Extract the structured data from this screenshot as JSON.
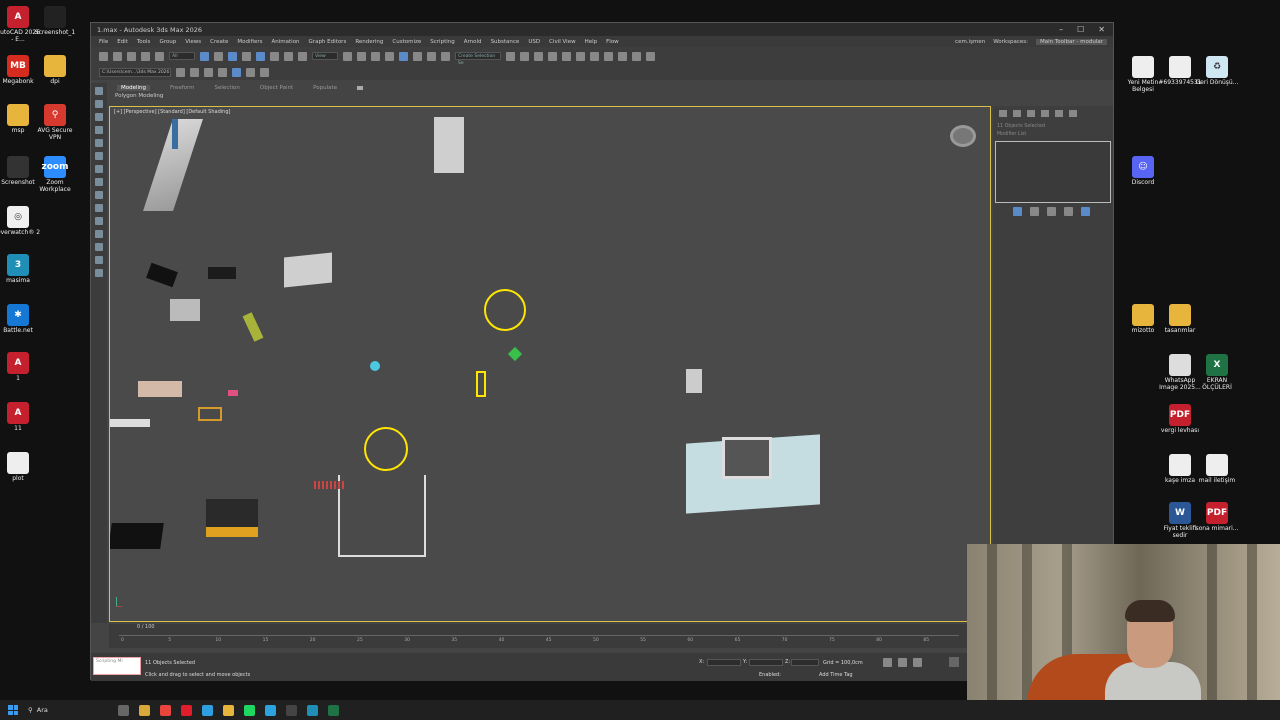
{
  "window": {
    "title": "1.max - Autodesk 3ds Max 2026",
    "controls": [
      "–",
      "☐",
      "✕"
    ]
  },
  "menu": {
    "items": [
      "File",
      "Edit",
      "Tools",
      "Group",
      "Views",
      "Create",
      "Modifiers",
      "Animation",
      "Graph Editors",
      "Rendering",
      "Customize",
      "Scripting",
      "Arnold",
      "Substance",
      "USD",
      "Civil View",
      "Help",
      "Flow"
    ],
    "user": "cem.işmen",
    "workspaces_label": "Workspaces:",
    "workspace_value": "Main Toolbar - modular"
  },
  "toolbar": {
    "selection_set": "Create Selection Se",
    "filter": "All",
    "view": "View",
    "path": "C:\\Users\\cem...\\3ds Max 2026"
  },
  "ribbon": {
    "tabs": [
      "Modeling",
      "Freeform",
      "Selection",
      "Object Paint",
      "Populate"
    ],
    "sub": "Polygon Modeling"
  },
  "viewport": {
    "label": "[+] [Perspective] [Standard] [Default Shading]"
  },
  "command_panel": {
    "selected_text": "11 Objects Selected",
    "modifier_list": "Modifier List"
  },
  "timeline": {
    "slider": "0 / 100",
    "ticks": [
      "0",
      "5",
      "10",
      "15",
      "20",
      "25",
      "30",
      "35",
      "40",
      "45",
      "50",
      "55",
      "60",
      "65",
      "70",
      "75",
      "80",
      "85"
    ]
  },
  "status": {
    "maxscript": "Scripting Mi",
    "selected": "11 Objects Selected",
    "hint": "Click and drag to select and move objects",
    "grid": "Grid = 100,0cm",
    "enabled": "Enabled:",
    "add_time_tag": "Add Time Tag",
    "x": "X:",
    "y": "Y:",
    "z": "Z:"
  },
  "desktop_left": [
    {
      "label": "AutoCAD 2026 - E...",
      "icon": "autocad-icon",
      "color": "#c4202e",
      "glyph": "A"
    },
    {
      "label": "Screenshot_1",
      "icon": "screenshot-file-icon",
      "color": "#222",
      "glyph": ""
    },
    {
      "label": "Megabonk",
      "icon": "megabonk-icon",
      "color": "#d62b1f",
      "glyph": "MB"
    },
    {
      "label": "dpi",
      "icon": "folder-icon",
      "color": "#e7b53c",
      "glyph": ""
    },
    {
      "label": "msp",
      "icon": "folder-icon",
      "color": "#e7b53c",
      "glyph": ""
    },
    {
      "label": "AVG Secure VPN",
      "icon": "avg-vpn-icon",
      "color": "#d63a2e",
      "glyph": "⚲"
    },
    {
      "label": "Screenshot",
      "icon": "lightshot-icon",
      "color": "#333",
      "glyph": ""
    },
    {
      "label": "Zoom Workplace",
      "icon": "zoom-icon",
      "color": "#2d8cff",
      "glyph": "zoom"
    },
    {
      "label": "Overwatch® 2",
      "icon": "overwatch-icon",
      "color": "#f0f0f0",
      "glyph": "◎"
    },
    {
      "label": "masima",
      "icon": "3dsmax-icon",
      "color": "#1f8fb8",
      "glyph": "3"
    },
    {
      "label": "Battle.net",
      "icon": "battlenet-icon",
      "color": "#1478d4",
      "glyph": "✱"
    },
    {
      "label": "1",
      "icon": "pdf-file-icon",
      "color": "#c4202e",
      "glyph": "A"
    },
    {
      "label": "11",
      "icon": "pdf-file-icon",
      "color": "#c4202e",
      "glyph": "A"
    },
    {
      "label": "plot",
      "icon": "text-file-icon",
      "color": "#eeeeee",
      "glyph": ""
    }
  ],
  "desktop_right": [
    {
      "label": "Yeni Metin Belgesi",
      "icon": "text-file-icon",
      "color": "#eeeeee",
      "glyph": ""
    },
    {
      "label": "#6933974531",
      "icon": "text-file-icon",
      "color": "#eeeeee",
      "glyph": ""
    },
    {
      "label": "Geri Dönüşü...",
      "icon": "recycle-bin-icon",
      "color": "#cfe6f3",
      "glyph": "♻"
    },
    {
      "label": "Discord",
      "icon": "discord-icon",
      "color": "#5865f2",
      "glyph": "☺"
    },
    {
      "label": "mizotto",
      "icon": "folder-icon",
      "color": "#e7b53c",
      "glyph": ""
    },
    {
      "label": "tasarımlar",
      "icon": "folder-icon",
      "color": "#e7b53c",
      "glyph": ""
    },
    {
      "label": "WhatsApp Image 2025...",
      "icon": "image-file-icon",
      "color": "#dddddd",
      "glyph": ""
    },
    {
      "label": "EKRAN ÖLÇÜLERİ",
      "icon": "excel-icon",
      "color": "#1f7244",
      "glyph": "X"
    },
    {
      "label": "vergi levhası",
      "icon": "pdf-icon",
      "color": "#c4202e",
      "glyph": "PDF"
    },
    {
      "label": "kaşe imza",
      "icon": "image-file-icon",
      "color": "#eeeeee",
      "glyph": ""
    },
    {
      "label": "mail iletişim",
      "icon": "text-file-icon",
      "color": "#eeeeee",
      "glyph": ""
    },
    {
      "label": "Fiyat teklifi sedir",
      "icon": "word-icon",
      "color": "#2b5797",
      "glyph": "W"
    },
    {
      "label": "sona mimari...",
      "icon": "pdf-icon",
      "color": "#c4202e",
      "glyph": "PDF"
    }
  ],
  "taskbar": {
    "search": "Ara",
    "apps": [
      {
        "icon": "taskview-icon",
        "color": "#666"
      },
      {
        "icon": "file-explorer-icon",
        "color": "#d9a93a"
      },
      {
        "icon": "chrome-icon",
        "color": "#e8453c"
      },
      {
        "icon": "opera-icon",
        "color": "#e01e2b"
      },
      {
        "icon": "edge-icon",
        "color": "#2ea0e0"
      },
      {
        "icon": "folder-icon",
        "color": "#e7b53c"
      },
      {
        "icon": "spotify-icon",
        "color": "#1ed760"
      },
      {
        "icon": "telegram-icon",
        "color": "#2aa3de"
      },
      {
        "icon": "steam-icon",
        "color": "#444"
      },
      {
        "icon": "3dsmax-icon",
        "color": "#1f8fb8"
      },
      {
        "icon": "excel-icon",
        "color": "#1f7244"
      }
    ]
  }
}
